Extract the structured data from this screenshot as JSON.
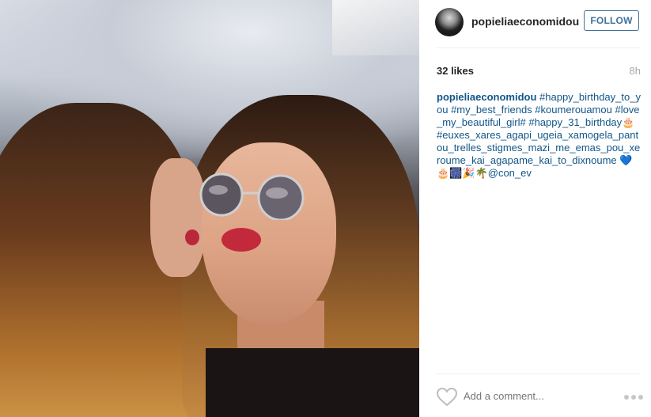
{
  "post": {
    "username": "popieliaeconomidou",
    "follow_label": "FOLLOW",
    "likes": "32 likes",
    "time": "8h",
    "caption_user": "popieliaeconomidou",
    "caption_text": "#happy_birthday_to_you #my_best_friends #koumerouamou #love_my_beautiful_girl# #happy_31_birthday🎂 #euxes_xares_agapi_ugeia_xamogela_pantou_trelles_stigmes_mazi_me_emas_pou_xeroume_kai_agapame_kai_to_dixnoume 💙🎂🎆🎉🌴@con_ev",
    "comment_placeholder": "Add a comment..."
  },
  "icons": {
    "avatar": "profile-photo",
    "like": "heart-icon",
    "more": "ellipsis-icon"
  },
  "colors": {
    "link": "#125688",
    "follow_border": "#3f729b",
    "muted": "#a5a7aa"
  }
}
